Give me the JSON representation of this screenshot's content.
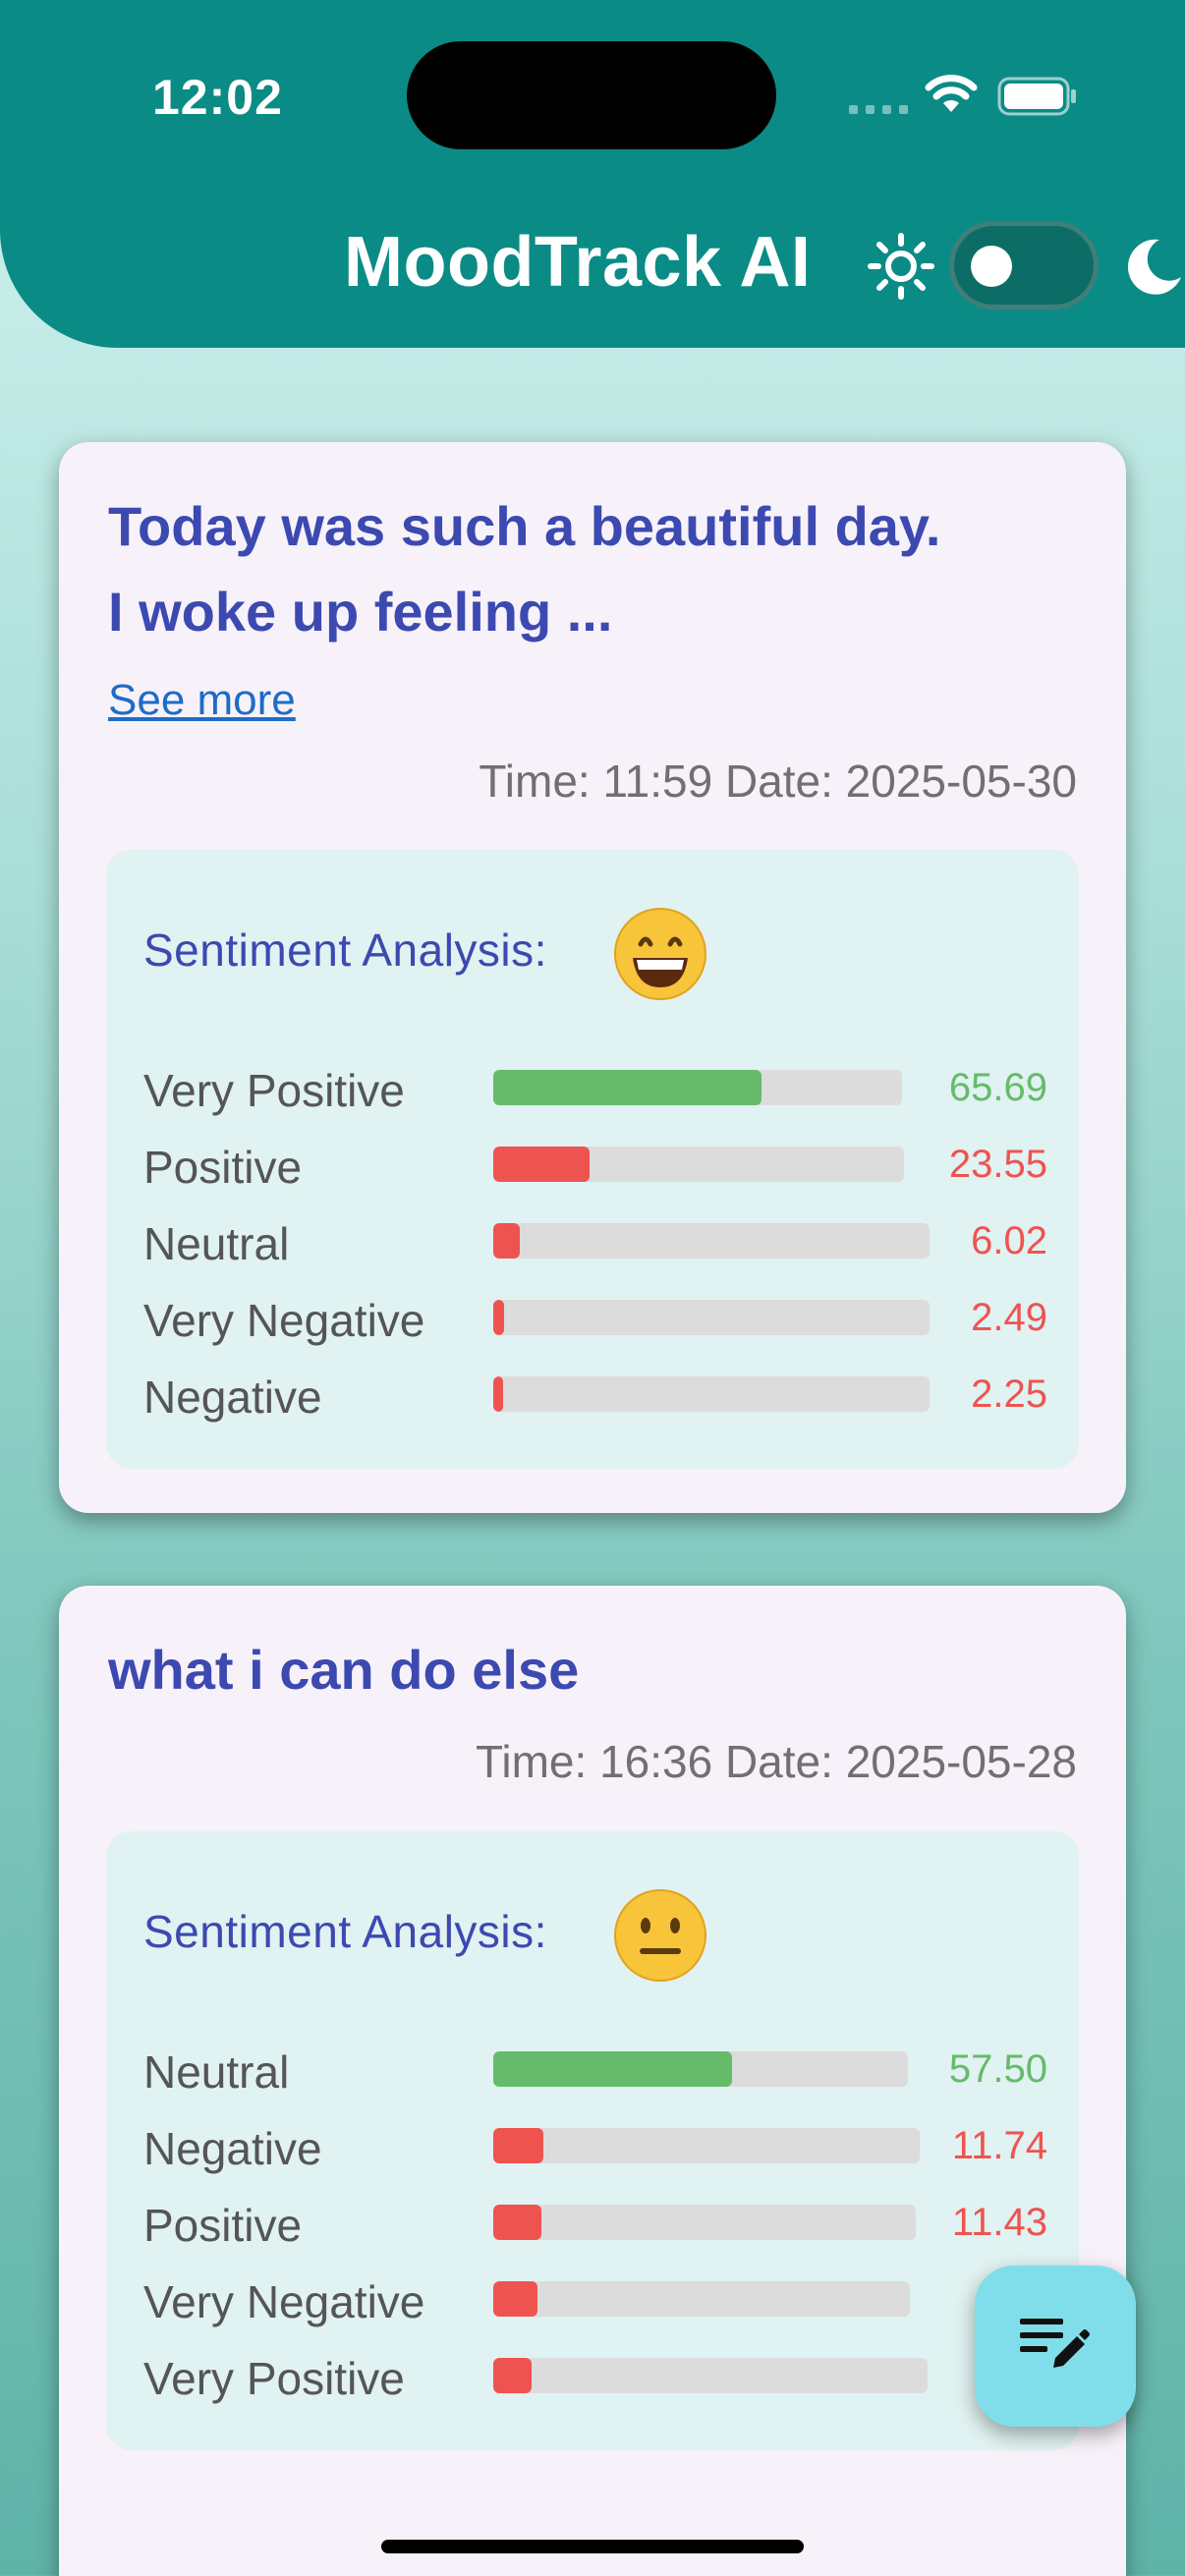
{
  "status_bar": {
    "time": "12:02"
  },
  "app_bar": {
    "title": "MoodTrack AI"
  },
  "entries": [
    {
      "text_line1": "Today was such a beautiful day.",
      "text_line2": "I woke up feeling ...",
      "see_more": "See more",
      "meta": "Time: 11:59 Date: 2025-05-30",
      "sentiment_title": "Sentiment Analysis:",
      "emoji": "grinning-face",
      "scores": [
        {
          "label": "Very Positive",
          "value": "65.69",
          "pct": 65.69,
          "color": "#66bb6a"
        },
        {
          "label": "Positive",
          "value": "23.55",
          "pct": 23.55,
          "color": "#ef5350"
        },
        {
          "label": "Neutral",
          "value": "6.02",
          "pct": 6.02,
          "color": "#ef5350"
        },
        {
          "label": "Very Negative",
          "value": "2.49",
          "pct": 2.49,
          "color": "#ef5350"
        },
        {
          "label": "Negative",
          "value": "2.25",
          "pct": 2.25,
          "color": "#ef5350"
        }
      ]
    },
    {
      "text_line1": "what i can do else",
      "meta": "Time: 16:36 Date: 2025-05-28",
      "sentiment_title": "Sentiment Analysis:",
      "emoji": "neutral-face",
      "scores": [
        {
          "label": "Neutral",
          "value": "57.50",
          "pct": 57.5,
          "color": "#66bb6a"
        },
        {
          "label": "Negative",
          "value": "11.74",
          "pct": 11.74,
          "color": "#ef5350"
        },
        {
          "label": "Positive",
          "value": "11.43",
          "pct": 11.43,
          "color": "#ef5350"
        },
        {
          "label": "Very Negative",
          "value": "10",
          "pct": 10.5,
          "color": "#ef5350"
        },
        {
          "label": "Very Positive",
          "value": "8",
          "pct": 8.8,
          "color": "#ef5350"
        }
      ]
    }
  ],
  "fab": {
    "icon": "edit-note-icon"
  }
}
